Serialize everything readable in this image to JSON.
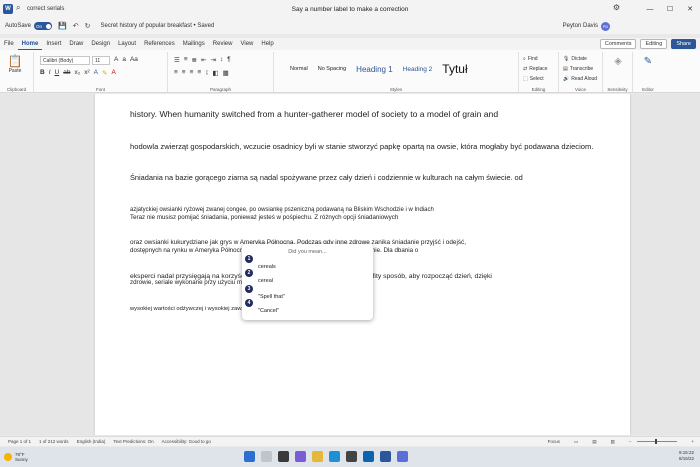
{
  "titlebar": {
    "search_text": "correct serials",
    "center_title": "Say a number label to make a correction"
  },
  "qat": {
    "autosave_label": "AutoSave",
    "autosave_state": "On",
    "doc_name": "Secret history of popular breakfast • Saved",
    "user_name": "Peyton Davis",
    "user_initials": "PD"
  },
  "tabs": [
    "File",
    "Home",
    "Insert",
    "Draw",
    "Design",
    "Layout",
    "References",
    "Mailings",
    "Review",
    "View",
    "Help"
  ],
  "active_tab": "Home",
  "tab_buttons": {
    "comments": "Comments",
    "editing": "Editing",
    "share": "Share"
  },
  "ribbon": {
    "paste_label": "Paste",
    "clipboard_label": "Clipboard",
    "font_name": "Calibri (Body)",
    "font_size": "11",
    "font_label": "Font",
    "paragraph_label": "Paragraph",
    "styles": [
      "Normal",
      "No Spacing",
      "Heading 1",
      "Heading 2",
      "Tytuł"
    ],
    "styles_label": "Styles",
    "editing_items": [
      "Find",
      "Replace",
      "Select"
    ],
    "editing_label": "Editing",
    "voice_items": [
      "Dictate",
      "Transcribe",
      "Read Aloud"
    ],
    "voice_label": "Voice",
    "sensitivity_label": "Sensitivity",
    "editor_label": "Editor"
  },
  "document": {
    "para1": [
      "history. When humanity switched from a hunter-gatherer model of society to a model of grain and",
      "hodowla zwierząt gospodarskich, wczucie osadnicy byli w stanie stworzyć papkę opartą na owsie, która mogłaby być podawana dzieciom.",
      "Śniadania na bazie gorącego ziarna są nadal spożywane przez cały dzień i codziennie w kulturach na całym świecie. od",
      "azjatyckiej owsianki ryżowej zwanej congee, po owsiankę pszeniczną podawaną na Bliskim Wschodzie i w Indiach",
      "oraz owsianki kukurydziane jak grys w Ameryka Północna. Podczas gdy inne zdrowe zanika śniadanie przyjść i odejść,",
      "eksperci nadal przysięgają na korzyści z płatków owsianych lub owsianki jako obfity sposób, aby rozpocząć dzień, dzięki",
      "wysokiej wartości odżywczej i wysokiej zawartości błonnika pełnoziarnistego."
    ],
    "para2": [
      "Teraz nie musisz pomijać śniadania, ponieważ jesteś w pośpiechu. Z różnych opcji śniadaniowych",
      "dostępnych na rynku w Ameryka Północna, można łatwo zjeść zdrowe i smaczne śniadanie. Dla dbania o",
      "zdrowie, seriale wykonane przy użyciu mąki pszennej i labiryntu są świetną alternatywą"
    ]
  },
  "popup": {
    "title": "Did you mean...",
    "options": [
      {
        "number": "1",
        "label": "cereals"
      },
      {
        "number": "2",
        "label": "cereal"
      },
      {
        "number": "3",
        "label": "\"Spell that\""
      },
      {
        "number": "4",
        "label": "\"Cancel\""
      }
    ]
  },
  "statusbar": {
    "page": "Page 1 of 1",
    "words": "1 of 212 words",
    "language": "English (India)",
    "text_predictions": "Text Predictions: On",
    "accessibility": "Accessibility: Good to go",
    "focus": "Focus"
  },
  "taskbar": {
    "temperature": "78°F",
    "weather": "Sunny",
    "time": "9:15:22",
    "date": "8/15/22"
  }
}
